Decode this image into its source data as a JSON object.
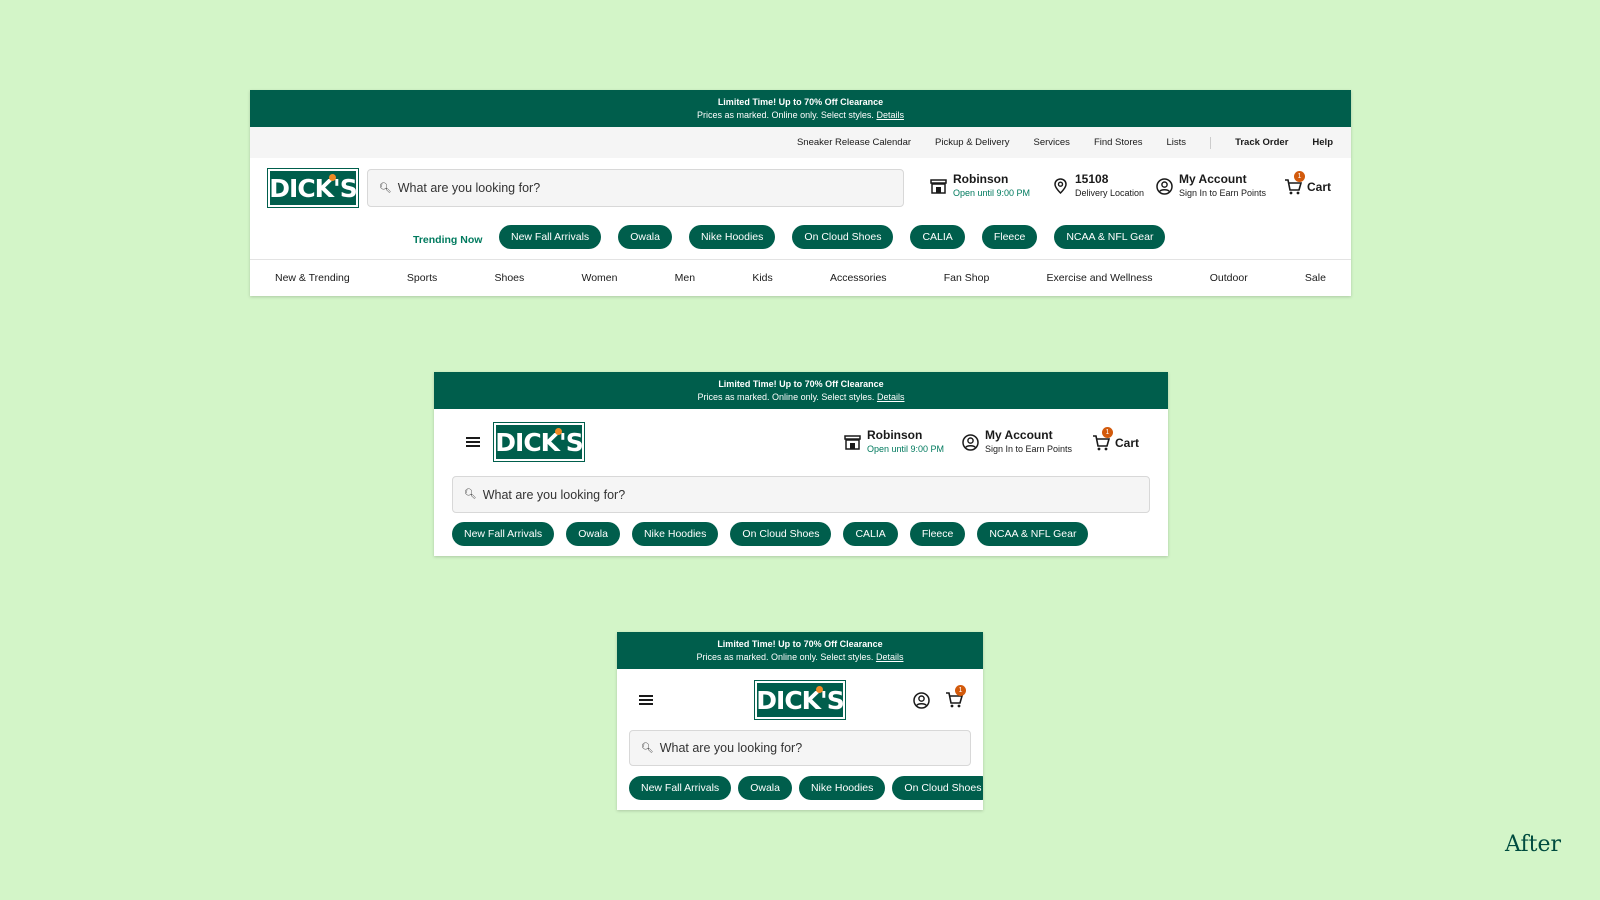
{
  "promo": {
    "title": "Limited Time! Up to 70% Off Clearance",
    "subtitle": "Prices as marked. Online only. Select styles.",
    "details_link": "Details"
  },
  "utility_links": [
    "Sneaker Release Calendar",
    "Pickup & Delivery",
    "Services",
    "Find Stores",
    "Lists"
  ],
  "utility_bold_links": [
    "Track Order",
    "Help"
  ],
  "logo_text": "DICK'S",
  "search": {
    "placeholder": "What are you looking for?"
  },
  "store": {
    "name": "Robinson",
    "hours": "Open until 9:00 PM"
  },
  "delivery": {
    "zip": "15108",
    "label": "Delivery Location"
  },
  "account": {
    "title": "My Account",
    "subtitle": "Sign In to Earn Points"
  },
  "cart": {
    "label": "Cart",
    "count": "1"
  },
  "trending_label": "Trending Now",
  "chips": [
    "New Fall Arrivals",
    "Owala",
    "Nike Hoodies",
    "On Cloud Shoes",
    "CALIA",
    "Fleece",
    "NCAA & NFL Gear"
  ],
  "nav": [
    "New & Trending",
    "Sports",
    "Shoes",
    "Women",
    "Men",
    "Kids",
    "Accessories",
    "Fan Shop",
    "Exercise and Wellness",
    "Outdoor",
    "Sale"
  ],
  "after_label": "After",
  "colors": {
    "brand": "#005e4c",
    "accent": "#f08a24",
    "badge": "#d25a0c",
    "background": "#d3f5c8"
  },
  "icons": [
    "search-icon",
    "store-icon",
    "location-pin-icon",
    "account-icon",
    "cart-icon",
    "hamburger-icon"
  ]
}
